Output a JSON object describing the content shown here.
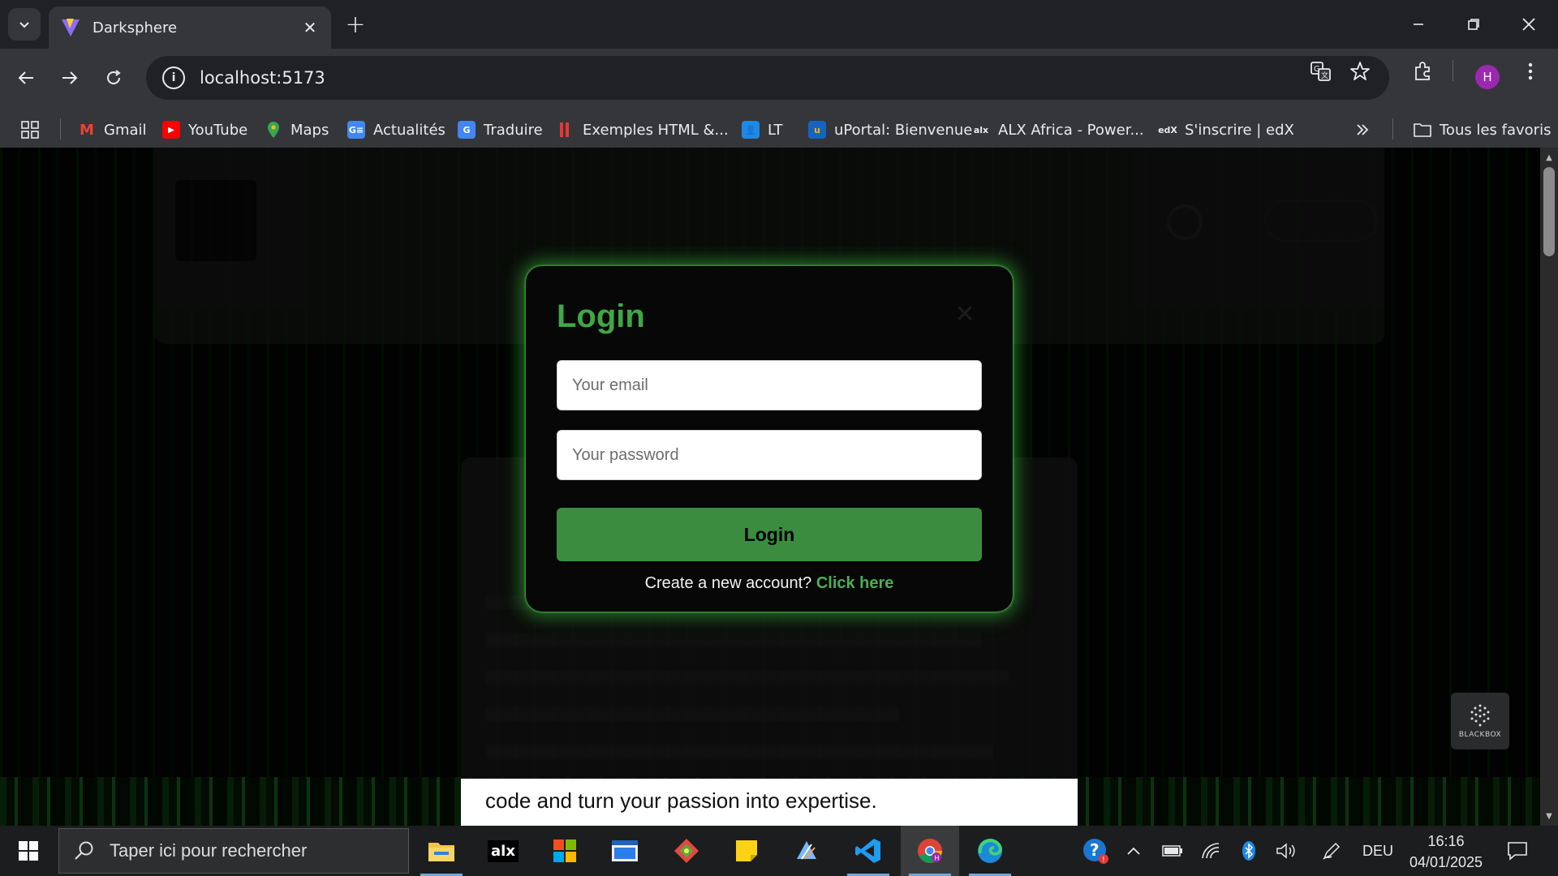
{
  "browser": {
    "tab_title": "Darksphere",
    "url": "localhost:5173",
    "profile_initial": "H",
    "bookmarks": [
      {
        "label": "Gmail",
        "icon": "gmail-icon"
      },
      {
        "label": "YouTube",
        "icon": "youtube-icon"
      },
      {
        "label": "Maps",
        "icon": "maps-icon"
      },
      {
        "label": "Actualités",
        "icon": "news-icon"
      },
      {
        "label": "Traduire",
        "icon": "translate-icon"
      },
      {
        "label": "Exemples HTML &...",
        "icon": "bars-icon"
      },
      {
        "label": "LT",
        "icon": "contact-icon"
      },
      {
        "label": "uPortal: Bienvenue",
        "icon": "uportal-icon"
      },
      {
        "label": "ALX Africa - Power...",
        "icon": "alx-icon"
      },
      {
        "label": "S'inscrire | edX",
        "icon": "edx-icon"
      }
    ],
    "all_bookmarks": "Tous les favoris"
  },
  "modal": {
    "title": "Login",
    "email_placeholder": "Your email",
    "password_placeholder": "Your password",
    "submit_label": "Login",
    "signup_prompt": "Create a new account?",
    "signup_link": "Click here"
  },
  "page": {
    "footer_text": "code and turn your passion into expertise."
  },
  "widget": {
    "label": "BLACKBOX"
  },
  "taskbar": {
    "search_placeholder": "Taper ici pour rechercher",
    "language": "DEU",
    "time": "16:16",
    "date": "04/01/2025"
  },
  "colors": {
    "accent_green": "#3fa845",
    "button_green": "#3b8c3f",
    "profile_purple": "#9c27b0"
  }
}
